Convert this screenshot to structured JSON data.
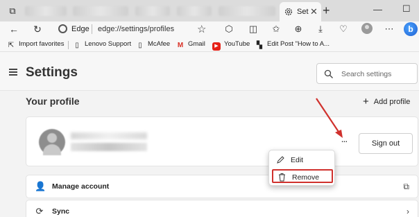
{
  "browser": {
    "tabs": [
      {
        "label": "Set",
        "active": true
      }
    ],
    "address": {
      "site": "Edge",
      "url": "edge://settings/profiles"
    },
    "favorites": [
      {
        "label": "Import favorites",
        "icon": "import-icon"
      },
      {
        "label": "Lenovo Support",
        "icon": "page-icon"
      },
      {
        "label": "McAfee",
        "icon": "page-icon"
      },
      {
        "label": "Gmail",
        "icon": "gmail-icon"
      },
      {
        "label": "YouTube",
        "icon": "youtube-icon"
      },
      {
        "label": "Edit Post \"How to A...",
        "icon": "wordpress-icon"
      }
    ]
  },
  "settings": {
    "title": "Settings",
    "search_placeholder": "Search settings"
  },
  "profile": {
    "section_title": "Your profile",
    "add_profile": "Add profile",
    "sign_out": "Sign out",
    "more_label": "...",
    "rows": [
      {
        "label": "Manage account",
        "icon": "person-icon",
        "trailing_icon": "external-link-icon"
      },
      {
        "label": "Sync",
        "icon": "sync-icon",
        "trailing_icon": "chevron-right-icon"
      }
    ]
  },
  "context_menu": {
    "items": [
      {
        "label": "Edit",
        "icon": "pencil-icon"
      },
      {
        "label": "Remove",
        "icon": "trash-icon",
        "highlighted": true
      }
    ]
  },
  "colors": {
    "highlight": "#d0312d",
    "arrow": "#d0312d"
  }
}
